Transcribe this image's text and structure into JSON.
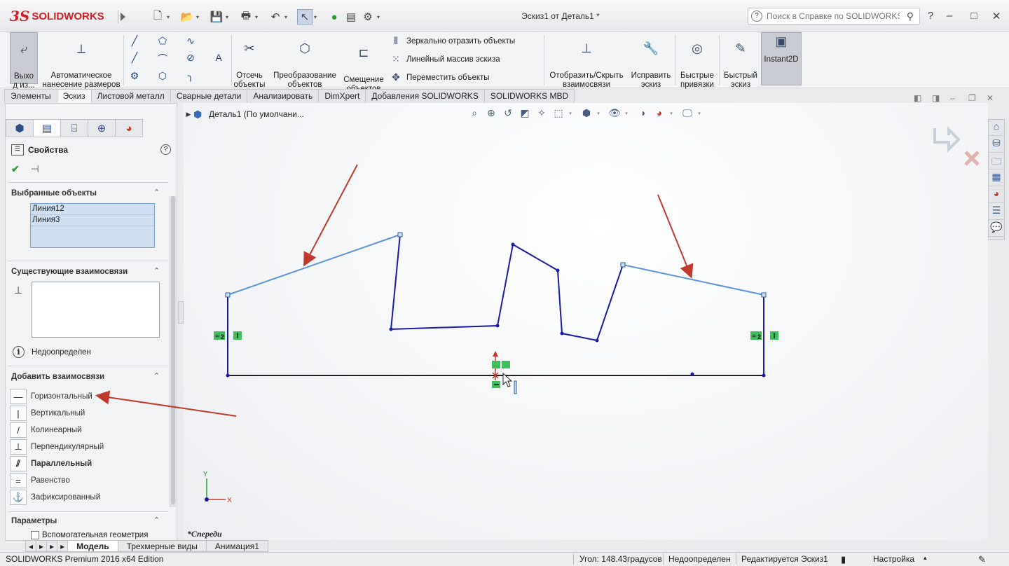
{
  "app": {
    "logo_ds": "3S",
    "logo_text": "SOLIDWORKS",
    "doc_title": "Эскиз1 от Деталь1 *",
    "help_search_placeholder": "Поиск в Справке по SOLIDWORKS",
    "help_icon": "question-circle-icon",
    "window_buttons": [
      "?",
      "–",
      "□",
      "✕"
    ]
  },
  "ribbon": {
    "exit_sketch": "Выхо\nд из...",
    "smart_dim": "Автоматическое\nнанесение размеров",
    "trim": "Отсечь\nобъекты",
    "convert": "Преобразование\nобъектов",
    "offset": "Смещение\nобъектов",
    "mirror": "Зеркально отразить объекты",
    "linear_pattern": "Линейный массив эскиза",
    "move": "Переместить объекты",
    "display_relations": "Отобразить/Скрыть\nвзаимосвязи",
    "repair": "Исправить\nэскиз",
    "quick_snaps": "Быстрые\nпривязки",
    "rapid_sketch": "Быстрый\nэскиз",
    "instant2d": "Instant2D"
  },
  "tabs": [
    "Элементы",
    "Эскиз",
    "Листовой металл",
    "Сварные детали",
    "Анализировать",
    "DimXpert",
    "Добавления SOLIDWORKS",
    "SOLIDWORKS MBD"
  ],
  "active_tab": "Эскиз",
  "panel": {
    "title": "Свойства",
    "selected_title": "Выбранные объекты",
    "selected_items": [
      "Линия12",
      "Линия3"
    ],
    "existing_title": "Существующие взаимосвязи",
    "status": "Недоопределен",
    "add_title": "Добавить взаимосвязи",
    "add_items": [
      {
        "label": "Горизонтальный",
        "icon": "horizontal-icon",
        "glyph": "—"
      },
      {
        "label": "Вертикальный",
        "icon": "vertical-icon",
        "glyph": "|"
      },
      {
        "label": "Колинеарный",
        "icon": "collinear-icon",
        "glyph": "/"
      },
      {
        "label": "Перпендикулярный",
        "icon": "perpendicular-icon",
        "glyph": "⊥"
      },
      {
        "label": "Параллельный",
        "icon": "parallel-icon",
        "glyph": "⫽"
      },
      {
        "label": "Равенство",
        "icon": "equal-icon",
        "glyph": "="
      },
      {
        "label": "Зафиксированный",
        "icon": "fix-icon",
        "glyph": "⚓"
      }
    ],
    "params_title": "Параметры",
    "construction_label": "Вспомогательная геометрия"
  },
  "viewport": {
    "tree_label": "Деталь1  (По умолчани...",
    "view_name": "*Спереди",
    "axis_x": "X",
    "axis_y": "Y",
    "relation_marks": [
      "2",
      "2"
    ]
  },
  "bottom_tabs": [
    "Модель",
    "Трехмерные виды",
    "Анимация1"
  ],
  "status": {
    "edition": "SOLIDWORKS Premium 2016 x64 Edition",
    "angle": "Угол: 148.43градусов",
    "definition": "Недоопределен",
    "editing": "Редактируется Эскиз1",
    "settings": "Настройка"
  },
  "colors": {
    "sketch_line": "#1a1aa8",
    "selected_line": "#5b95d9",
    "annotation_arrow": "#c0392b",
    "relation_green": "#3fbf5a",
    "brand_red": "#d21e25"
  }
}
